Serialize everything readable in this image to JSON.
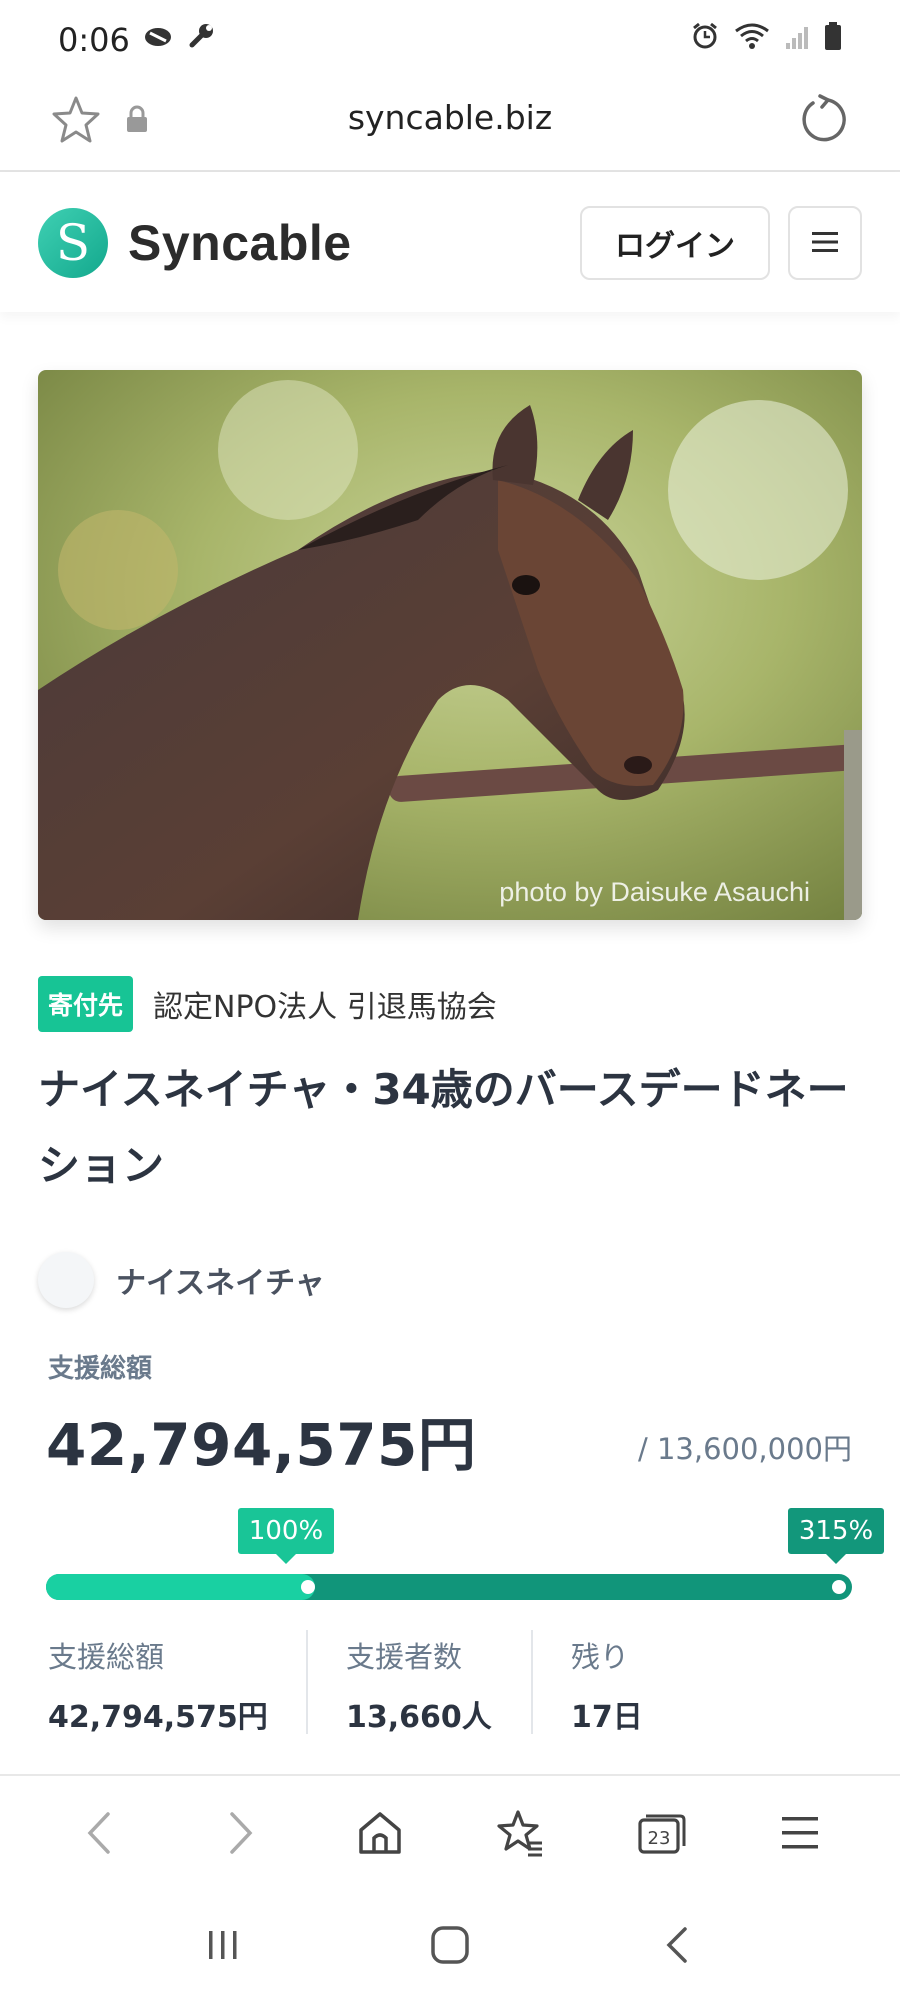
{
  "status_bar": {
    "time": "0:06"
  },
  "browser": {
    "url": "syncable.biz"
  },
  "site": {
    "logo_text": "Syncable",
    "logo_letter": "S",
    "login_label": "ログイン",
    "brand_color": "#17c495"
  },
  "hero": {
    "photo_credit": "photo by Daisuke Asauchi"
  },
  "recipient": {
    "badge": "寄付先",
    "name": "認定NPO法人 引退馬協会"
  },
  "campaign": {
    "title": "ナイスネイチャ・34歳のバースデードネーション",
    "owner": "ナイスネイチャ"
  },
  "funding": {
    "total_label": "支援総額",
    "total_amount": "42,794,575円",
    "goal": "/ 13,600,000円",
    "milestone_label": "100%",
    "percent_label": "315%",
    "percent_value": 315
  },
  "stats": [
    {
      "label": "支援総額",
      "value": "42,794,575円"
    },
    {
      "label": "支援者数",
      "value": "13,660人"
    },
    {
      "label": "残り",
      "value": "17日"
    }
  ],
  "bottom_nav": {
    "tabs_count": "23"
  }
}
